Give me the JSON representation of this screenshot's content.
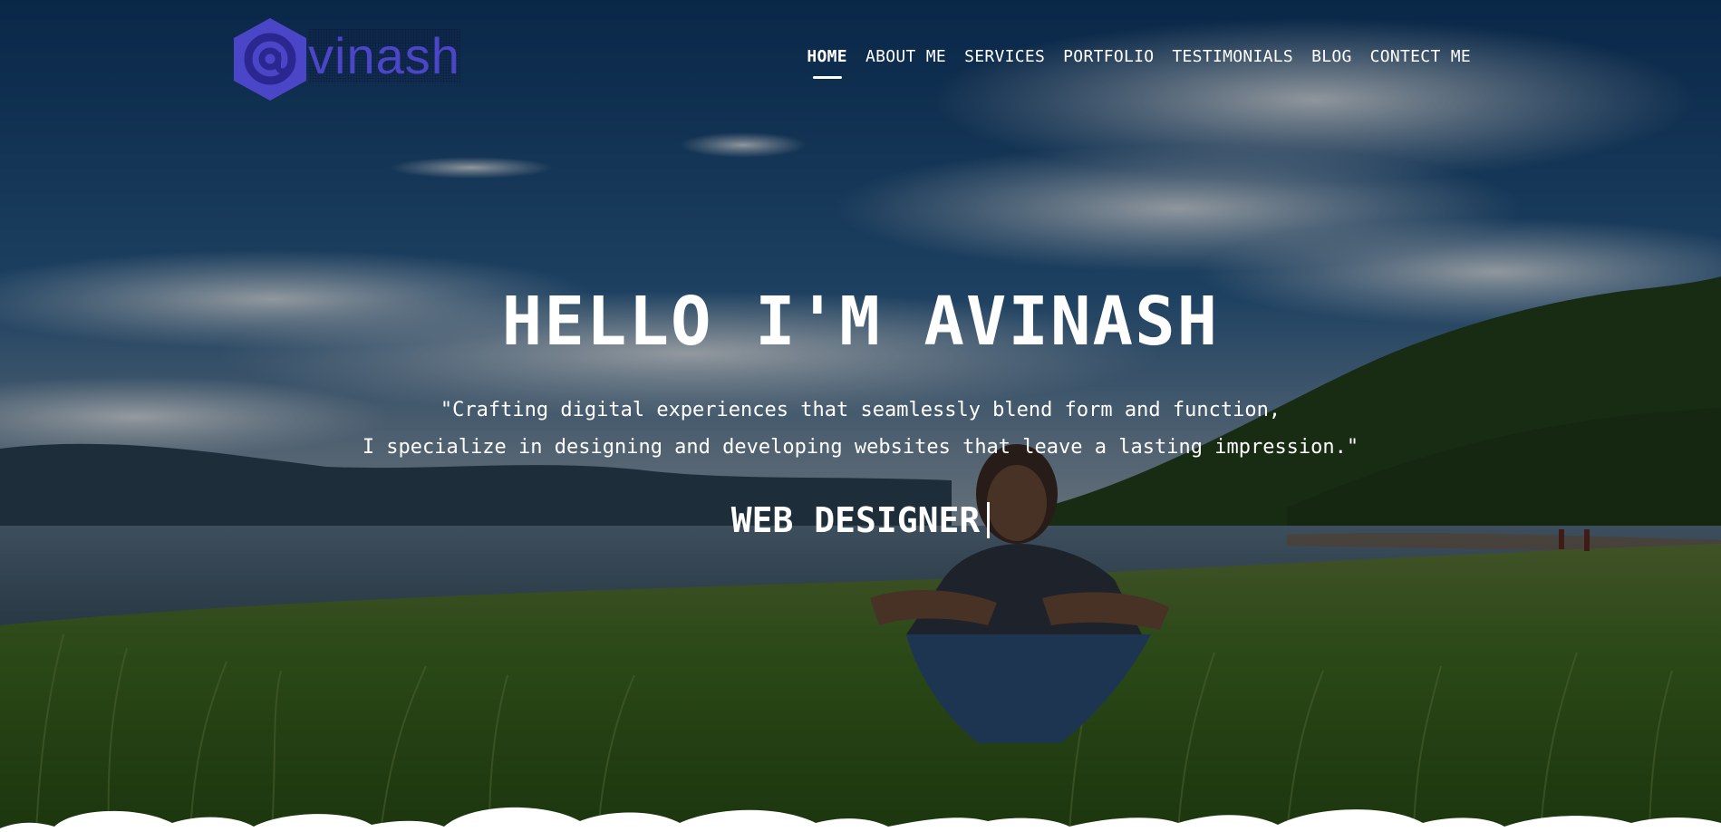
{
  "logo": {
    "glyph": "@",
    "word": "vinash"
  },
  "nav": {
    "items": [
      {
        "label": "HOME",
        "active": true
      },
      {
        "label": "ABOUT ME",
        "active": false
      },
      {
        "label": "SERVICES",
        "active": false
      },
      {
        "label": "PORTFOLIO",
        "active": false
      },
      {
        "label": "TESTIMONIALS",
        "active": false
      },
      {
        "label": "BLOG",
        "active": false
      },
      {
        "label": "CONTECT ME",
        "active": false
      }
    ]
  },
  "hero": {
    "title": "HELLO I'M AVINASH",
    "quote_line1": "\"Crafting digital experiences that seamlessly blend form and function,",
    "quote_line2": "I specialize in designing and developing websites that leave a lasting impression.\"",
    "role": "WEB DESIGNER"
  },
  "colors": {
    "brand": "#4b46c8",
    "text": "#ffffff",
    "sky": "#1c4b7a",
    "grass": "#2f5a1c"
  },
  "icons": {
    "logo": "hexagon-at-logo-icon",
    "cursor": "typing-cursor"
  }
}
